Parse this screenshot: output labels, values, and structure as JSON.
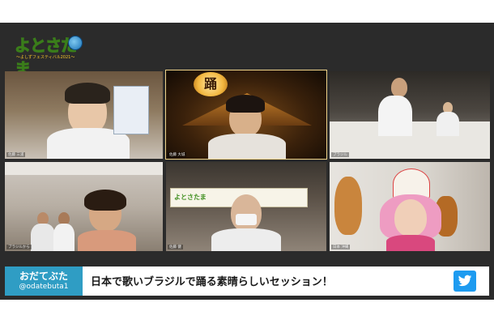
{
  "logo": {
    "text": "よとさたま",
    "subtitle": "〜よしずフェスティバル2021〜"
  },
  "tiles": [
    {
      "id": "t1",
      "tag": "佐藤 三浦"
    },
    {
      "id": "t2",
      "tag": "佐藤 大城"
    },
    {
      "id": "t3",
      "tag": "ブラジル"
    },
    {
      "id": "t4",
      "tag": "ブラジルから"
    },
    {
      "id": "t5",
      "tag": "佐藤 健"
    },
    {
      "id": "t6",
      "tag": "日本 沖縄"
    }
  ],
  "lantern_char": "踊",
  "banner": {
    "text": "よとさたま"
  },
  "caption": {
    "name": "おだてぶた",
    "handle": "@odatebuta1",
    "message": "日本で歌いブラジルで踊る素晴らしいセッション！"
  },
  "colors": {
    "stage": "#2b2b2b",
    "name_box": "#2f9dc4",
    "twitter": "#1d9bf0"
  },
  "icons": {
    "twitter": "twitter-icon"
  }
}
